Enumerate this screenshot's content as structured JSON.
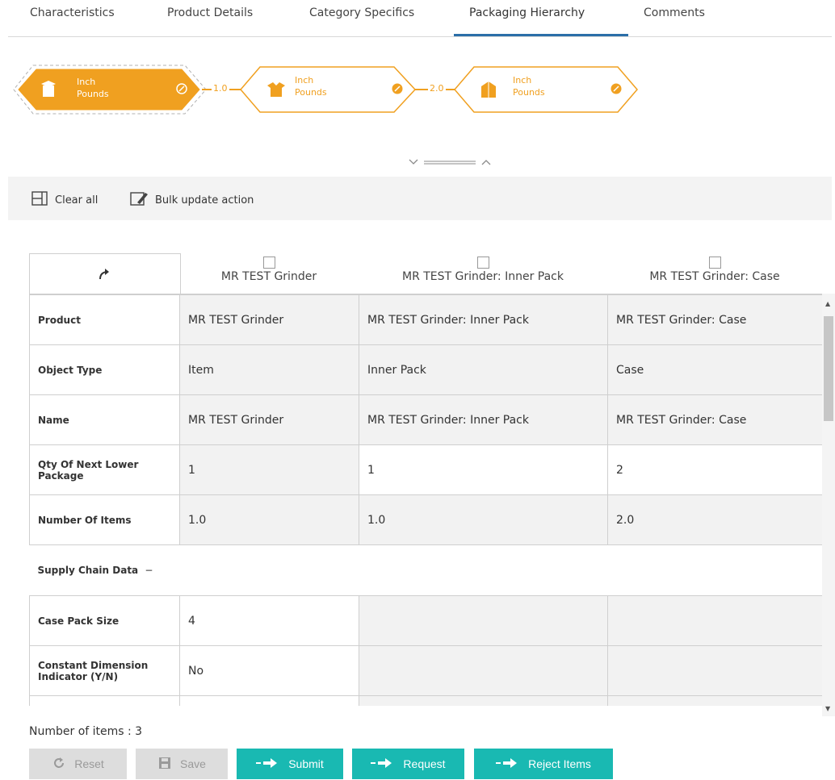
{
  "tabs": [
    "Characteristics",
    "Product Details",
    "Category Specifics",
    "Packaging Hierarchy",
    "Comments"
  ],
  "hierarchy": {
    "nodes": [
      {
        "line1": "Inch",
        "line2": "Pounds"
      },
      {
        "line1": "Inch",
        "line2": "Pounds"
      },
      {
        "line1": "Inch",
        "line2": "Pounds"
      }
    ],
    "connectors": [
      "1.0",
      "2.0"
    ]
  },
  "actions": {
    "clear_all": "Clear all",
    "bulk_update": "Bulk update action"
  },
  "columns": [
    "MR TEST Grinder",
    "MR TEST Grinder: Inner Pack",
    "MR TEST Grinder: Case"
  ],
  "rows": [
    {
      "label": "Product",
      "values": [
        "MR TEST Grinder",
        "MR TEST Grinder: Inner Pack",
        "MR TEST Grinder: Case"
      ]
    },
    {
      "label": "Object Type",
      "values": [
        "Item",
        "Inner Pack",
        "Case"
      ]
    },
    {
      "label": "Name",
      "values": [
        "MR TEST Grinder",
        "MR TEST Grinder: Inner Pack",
        "MR TEST Grinder: Case"
      ]
    },
    {
      "label": "Qty Of Next Lower Package",
      "values": [
        "1",
        "1",
        "2"
      ]
    },
    {
      "label": "Number Of Items",
      "values": [
        "1.0",
        "1.0",
        "2.0"
      ]
    }
  ],
  "section": {
    "label": "Supply Chain Data",
    "toggle": "−"
  },
  "section_rows": [
    {
      "label": "Case Pack Size",
      "values": [
        "4",
        "",
        ""
      ]
    },
    {
      "label": "Constant Dimension Indicator (Y/N)",
      "values": [
        "No",
        "",
        ""
      ]
    },
    {
      "label": "",
      "values": [
        "",
        "",
        ""
      ]
    }
  ],
  "footer": {
    "count_label": "Number of items : 3"
  },
  "buttons": {
    "reset": "Reset",
    "save": "Save",
    "submit": "Submit",
    "request": "Request",
    "reject": "Reject Items"
  },
  "colors": {
    "accent_orange": "#f0a020",
    "teal": "#19b9b2",
    "tab_underline": "#2b6ea8"
  }
}
